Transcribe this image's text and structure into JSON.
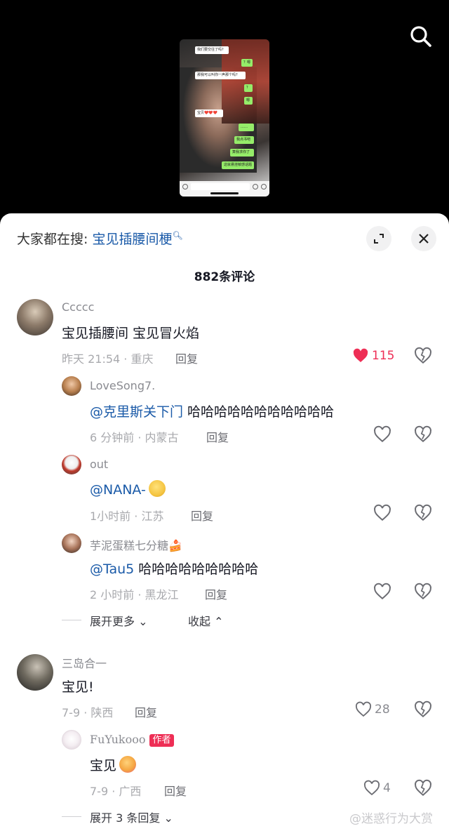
{
  "video": {
    "thumbnail_messages_left": [
      "我们要交往了吗?",
      "那我可以叫你一声那个吗?",
      "宝贝❤️❤️❤️"
    ],
    "thumbnail_messages_right": [
      "？嗯",
      "？",
      "嗯",
      "……",
      "我点书吧",
      "算我求你了",
      "这就悬挂敏感话题"
    ]
  },
  "panel": {
    "hot_search_prefix": "大家都在搜:",
    "hot_search_keyword": "宝见插腰间梗",
    "comment_count": "882条评论"
  },
  "comments": [
    {
      "user": "Ccccc",
      "text": "宝见插腰间 宝见冒火焰",
      "meta": "昨天 21:54 · 重庆",
      "reply": "回复",
      "likes": "115",
      "liked": true,
      "replies": [
        {
          "user": "LoveSong7.",
          "mention": "@克里斯关下门",
          "text": " 哈哈哈哈哈哈哈哈哈哈哈",
          "meta": "6 分钟前 · 内蒙古",
          "reply": "回复"
        },
        {
          "user": "out",
          "mention": "@NANA-",
          "text": "",
          "meta": "1小时前 · 江苏",
          "reply": "回复"
        },
        {
          "user": "芋泥蛋糕七分糖🍰",
          "mention": "@Tau5",
          "text": " 哈哈哈哈哈哈哈哈哈",
          "meta": "2 小时前 · 黑龙江",
          "reply": "回复"
        }
      ],
      "expand_more": "展开更多",
      "collapse": "收起"
    },
    {
      "user": "三岛合一",
      "text": "宝见!",
      "meta": "7-9 · 陕西",
      "reply": "回复",
      "likes": "28",
      "replies": [
        {
          "user": "FuYukooo",
          "badge": "作者",
          "text": "宝见",
          "meta": "7-9 · 广西",
          "reply": "回复",
          "likes": "4"
        }
      ],
      "expand_more": "展开 3 条回复"
    }
  ],
  "watermark": "@迷惑行为大赏",
  "colors": {
    "accent_red": "#ee2e55",
    "link_blue": "#1a5aa8",
    "panel_bg": "#ffffff",
    "video_bg": "#000000"
  }
}
